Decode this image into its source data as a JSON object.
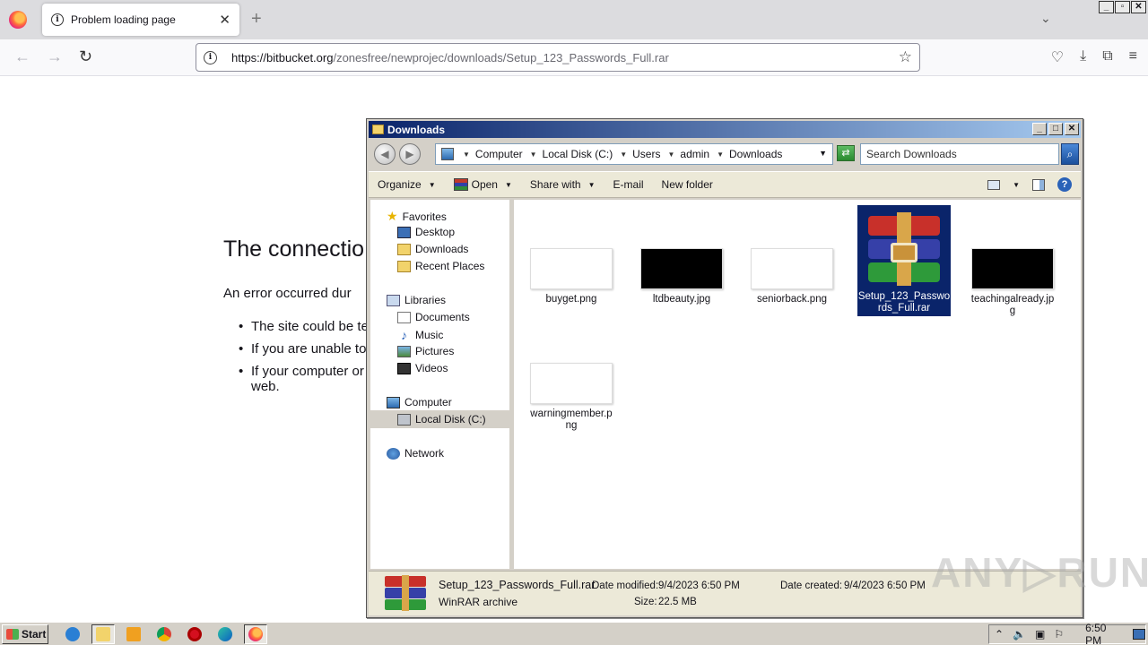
{
  "browser": {
    "tab_title": "Problem loading page",
    "tab_close": "✕",
    "new_tab": "+",
    "list_all_tabs": "⌄",
    "url_host": "https://bitbucket.org",
    "url_path": "/zonesfree/newprojec/downloads/Setup_123_Passwords_Full.rar",
    "window_controls": [
      "_",
      "▫",
      "✕"
    ]
  },
  "error_page": {
    "title": "The connectio",
    "description": "An error occurred dur",
    "bullets": [
      "The site could be te",
      "If you are unable to",
      "If your computer or",
      "web."
    ]
  },
  "explorer": {
    "title": "Downloads",
    "breadcrumbs": [
      "Computer",
      "Local Disk (C:)",
      "Users",
      "admin",
      "Downloads"
    ],
    "search_placeholder": "Search Downloads",
    "commands": {
      "organize": "Organize",
      "open": "Open",
      "share_with": "Share with",
      "email": "E-mail",
      "new_folder": "New folder"
    },
    "nav": {
      "favorites": "Favorites",
      "desktop": "Desktop",
      "downloads": "Downloads",
      "recent_places": "Recent Places",
      "libraries": "Libraries",
      "documents": "Documents",
      "music": "Music",
      "pictures": "Pictures",
      "videos": "Videos",
      "computer": "Computer",
      "local_disk": "Local Disk (C:)",
      "network": "Network"
    },
    "files": [
      {
        "name": "buyget.png",
        "thumb": "#ffffff"
      },
      {
        "name": "ltdbeauty.jpg",
        "thumb": "#000000"
      },
      {
        "name": "seniorback.png",
        "thumb": "#ffffff"
      },
      {
        "name": "Setup_123_Passwords_Full.rar",
        "thumb": "winrar",
        "selected": true
      },
      {
        "name": "teachingalready.jpg",
        "thumb": "#000000"
      },
      {
        "name": "warningmember.png",
        "thumb": "#ffffff"
      }
    ],
    "details": {
      "name": "Setup_123_Passwords_Full.rar",
      "type": "WinRAR archive",
      "modified_label": "Date modified:",
      "modified": "9/4/2023 6:50 PM",
      "size_label": "Size:",
      "size": "22.5 MB",
      "created_label": "Date created:",
      "created": "9/4/2023 6:50 PM"
    }
  },
  "watermark": "ANY▷RUN",
  "taskbar": {
    "start_label": "Start",
    "clock": "6:50 PM",
    "apps": [
      "internet-explorer",
      "file-explorer",
      "media-player",
      "chrome",
      "opera",
      "edge",
      "firefox"
    ]
  }
}
